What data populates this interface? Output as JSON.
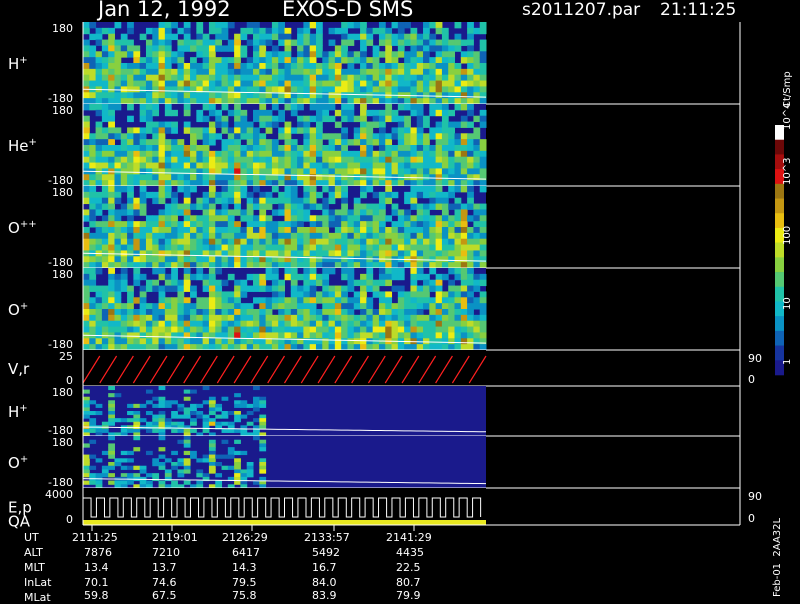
{
  "header": {
    "date": "Jan 12, 1992",
    "instrument": "EXOS-D SMS",
    "file": "s2011207.par",
    "time": "21:11:25"
  },
  "colorbar": {
    "unit": "Ct/Smp",
    "ticks": [
      "1",
      "10",
      "100",
      "10^3",
      "10^4"
    ],
    "colors": [
      "#1a1a8c",
      "#16349e",
      "#0f63b5",
      "#0a92c4",
      "#11b8c8",
      "#20c2a8",
      "#55c873",
      "#88d040",
      "#bedc28",
      "#ecec14",
      "#e8be10",
      "#c49712",
      "#9c7612",
      "#dd1111",
      "#a40d0d",
      "#6c0808",
      "#ffffff"
    ]
  },
  "side_labels": {
    "right_axis_top": "90",
    "right_axis_bottom": "0",
    "bottom_code": "Feb-01  2AA32L"
  },
  "chart_data": {
    "type": "heatmap",
    "x_time_ut": [
      "2111:25",
      "2119:01",
      "2126:29",
      "2133:57",
      "2141:29"
    ],
    "panels": [
      {
        "label": "H",
        "charge": "+",
        "y_top": "180",
        "y_bot": "-180",
        "kind": "spectrogram",
        "data_end": 0.82
      },
      {
        "label": "He",
        "charge": "+",
        "y_top": "180",
        "y_bot": "-180",
        "kind": "spectrogram",
        "data_end": 0.82
      },
      {
        "label": "O",
        "charge": "++",
        "y_top": "180",
        "y_bot": "-180",
        "kind": "spectrogram",
        "data_end": 0.82
      },
      {
        "label": "O",
        "charge": "+",
        "y_top": "180",
        "y_bot": "-180",
        "kind": "spectrogram",
        "data_end": 0.82
      },
      {
        "label": "V,r",
        "y_top": "25",
        "y_bot": "0",
        "right_top": "90",
        "right_bot": "0",
        "kind": "sawtooth"
      },
      {
        "label": "H",
        "charge": "+",
        "y_top": "180",
        "y_bot": "-180",
        "kind": "spectrogram",
        "data_end": 0.82,
        "sparse": true
      },
      {
        "label": "O",
        "charge": "+",
        "y_top": "180",
        "y_bot": "-180",
        "kind": "spectrogram",
        "data_end": 0.82,
        "sparse": true
      },
      {
        "label": "E,p",
        "label2": "QA",
        "y_top": "4000",
        "y_bot": "0",
        "right_top": "90",
        "right_bot": "0",
        "kind": "steps"
      }
    ],
    "table": {
      "row_labels": [
        "UT",
        "ALT",
        "MLT",
        "InLat",
        "MLat"
      ],
      "rows": [
        [
          "2111:25",
          "2119:01",
          "2126:29",
          "2133:57",
          "2141:29"
        ],
        [
          "7876",
          "7210",
          "6417",
          "5492",
          "4435"
        ],
        [
          "13.4",
          "13.7",
          "14.3",
          "16.7",
          "22.5"
        ],
        [
          "70.1",
          "74.6",
          "79.5",
          "84.0",
          "80.7"
        ],
        [
          "59.8",
          "67.5",
          "75.8",
          "83.9",
          "79.9"
        ]
      ]
    }
  }
}
